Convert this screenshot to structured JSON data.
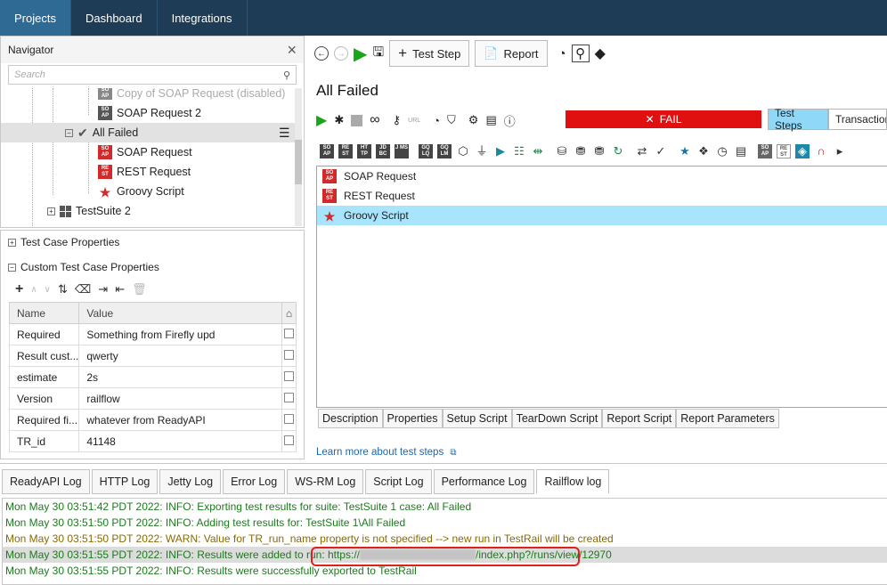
{
  "top_tabs": [
    {
      "label": "Projects"
    },
    {
      "label": "Dashboard"
    },
    {
      "label": "Integrations"
    }
  ],
  "navigator": {
    "title": "Navigator",
    "close_icon": "×",
    "search_placeholder": "Search",
    "tree": [
      {
        "label": "Copy of SOAP Request (disabled)",
        "icon": "soap-disabled",
        "icon_text": "SO AP"
      },
      {
        "label": "SOAP Request 2",
        "icon": "soap",
        "icon_text": "SO AP"
      },
      {
        "label": "All Failed",
        "icon": "check"
      },
      {
        "label": "SOAP Request",
        "icon": "soap",
        "icon_text": "SO AP"
      },
      {
        "label": "REST Request",
        "icon": "rest",
        "icon_text": "RE ST"
      },
      {
        "label": "Groovy Script",
        "icon": "star"
      },
      {
        "label": "TestSuite 2",
        "icon": "grid"
      }
    ]
  },
  "properties": {
    "test_case_props": "Test Case Properties",
    "custom_props": "Custom Test Case Properties",
    "columns": [
      "Name",
      "Value"
    ],
    "rows": [
      {
        "name": "Required",
        "value": "Something from Firefly upd"
      },
      {
        "name": "Result cust...",
        "value": "qwerty"
      },
      {
        "name": "estimate",
        "value": "2s"
      },
      {
        "name": "Version",
        "value": "railflow"
      },
      {
        "name": "Required fi...",
        "value": "whatever from ReadyAPI"
      },
      {
        "name": "TR_id",
        "value": "41148"
      }
    ]
  },
  "main": {
    "test_step_btn": "Test Step",
    "report_btn": "Report",
    "title": "All Failed",
    "url_label": "URL",
    "fail_label": "FAIL",
    "view_tabs": [
      {
        "label": "Test Steps"
      },
      {
        "label": "Transactions"
      }
    ],
    "icon_labels": [
      "SO AP",
      "RE ST",
      "HT TP",
      "JD BC",
      "J MS",
      "GQ LQ",
      "GQ LM"
    ],
    "icon_labels2": [
      "SO AP",
      "RE ST"
    ],
    "steps": [
      {
        "label": "SOAP Request",
        "icon_text": "SO AP"
      },
      {
        "label": "REST Request",
        "icon_text": "RE ST"
      },
      {
        "label": "Groovy Script"
      }
    ],
    "bottom_tabs": [
      "Description",
      "Properties",
      "Setup Script",
      "TearDown Script",
      "Report Script",
      "Report Parameters"
    ],
    "learn_more": "Learn more about test steps"
  },
  "logs": {
    "tabs": [
      "ReadyAPI Log",
      "HTTP Log",
      "Jetty Log",
      "Error Log",
      "WS-RM Log",
      "Script Log",
      "Performance Log",
      "Railflow log"
    ],
    "lines": [
      {
        "text": "Mon May 30 03:51:42 PDT 2022: INFO: Exporting test results for suite: TestSuite 1 case: All Failed",
        "level": "info"
      },
      {
        "text": "Mon May 30 03:51:50 PDT 2022: INFO: Adding test results for: TestSuite 1\\All Failed",
        "level": "info"
      },
      {
        "text": "Mon May 30 03:51:50 PDT 2022: WARN: Value for TR_run_name property is not specified --> new run in TestRail will be created",
        "level": "warn"
      },
      {
        "text": "Mon May 30 03:51:55 PDT 2022: INFO: Results were added to run: https://",
        "suffix": "/index.php?/runs/view/12970",
        "level": "info"
      },
      {
        "text": "Mon May 30 03:51:55 PDT 2022: INFO: Results were successfully exported to TestRail",
        "level": "info"
      }
    ]
  }
}
